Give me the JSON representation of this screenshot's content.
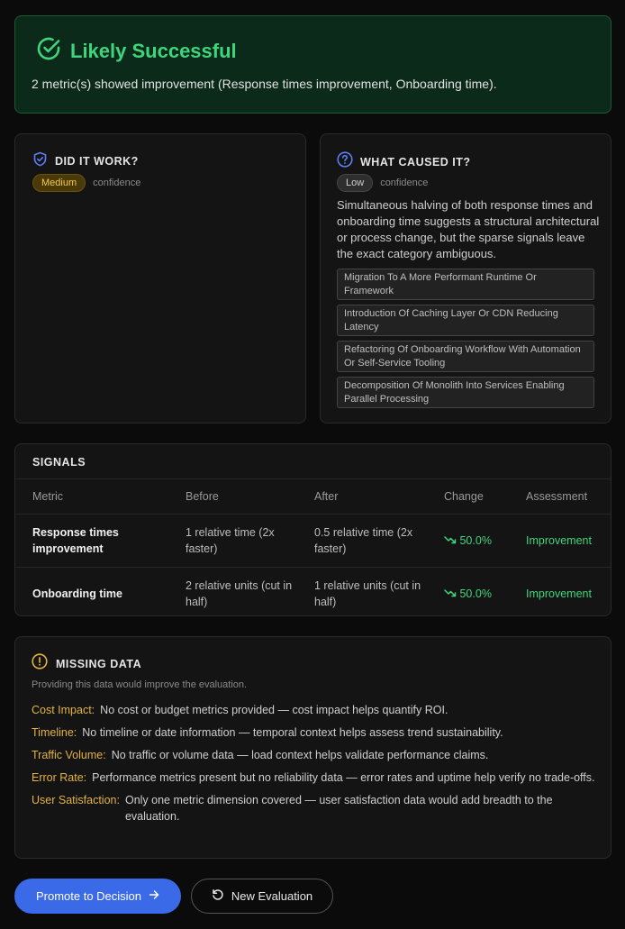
{
  "banner": {
    "title": "Likely Successful",
    "message": "2 metric(s) showed improvement (Response times improvement, Onboarding time).",
    "icon": "check-circle-icon",
    "color": "#3fd57d"
  },
  "did_it_work": {
    "title": "DID IT WORK?",
    "icon": "shield-check-icon",
    "confidence_level": "Medium",
    "confidence_label": "confidence"
  },
  "what_caused": {
    "title": "WHAT CAUSED IT?",
    "icon": "question-circle-icon",
    "confidence_level": "Low",
    "confidence_label": "confidence",
    "description": "Simultaneous halving of both response times and onboarding time suggests a structural architectural or process change, but the sparse signals leave the exact category ambiguous.",
    "causes": [
      "Migration To A More Performant Runtime Or Framework",
      "Introduction Of Caching Layer Or CDN Reducing Latency",
      "Refactoring Of Onboarding Workflow With Automation Or Self-Service Tooling",
      "Decomposition Of Monolith Into Services Enabling Parallel Processing"
    ]
  },
  "signals": {
    "title": "SIGNALS",
    "columns": [
      "Metric",
      "Before",
      "After",
      "Change",
      "Assessment"
    ],
    "rows": [
      {
        "metric": "Response times improvement",
        "before": "1 relative time (2x faster)",
        "after": "0.5 relative time (2x faster)",
        "change": "50.0%",
        "assessment": "Improvement"
      },
      {
        "metric": "Onboarding time",
        "before": "2 relative units (cut in half)",
        "after": "1 relative units (cut in half)",
        "change": "50.0%",
        "assessment": "Improvement"
      }
    ]
  },
  "missing": {
    "title": "MISSING DATA",
    "icon": "alert-circle-icon",
    "subtitle": "Providing this data would improve the evaluation.",
    "items": [
      {
        "key": "Cost Impact:",
        "text": "No cost or budget metrics provided — cost impact helps quantify ROI."
      },
      {
        "key": "Timeline:",
        "text": "No timeline or date information — temporal context helps assess trend sustainability."
      },
      {
        "key": "Traffic Volume:",
        "text": "No traffic or volume data — load context helps validate performance claims."
      },
      {
        "key": "Error Rate:",
        "text": "Performance metrics present but no reliability data — error rates and uptime help verify no trade-offs."
      },
      {
        "key": "User Satisfaction:",
        "text": "Only one metric dimension covered — user satisfaction data would add breadth to the evaluation."
      }
    ]
  },
  "actions": {
    "promote_label": "Promote to Decision",
    "new_eval_label": "New Evaluation"
  }
}
